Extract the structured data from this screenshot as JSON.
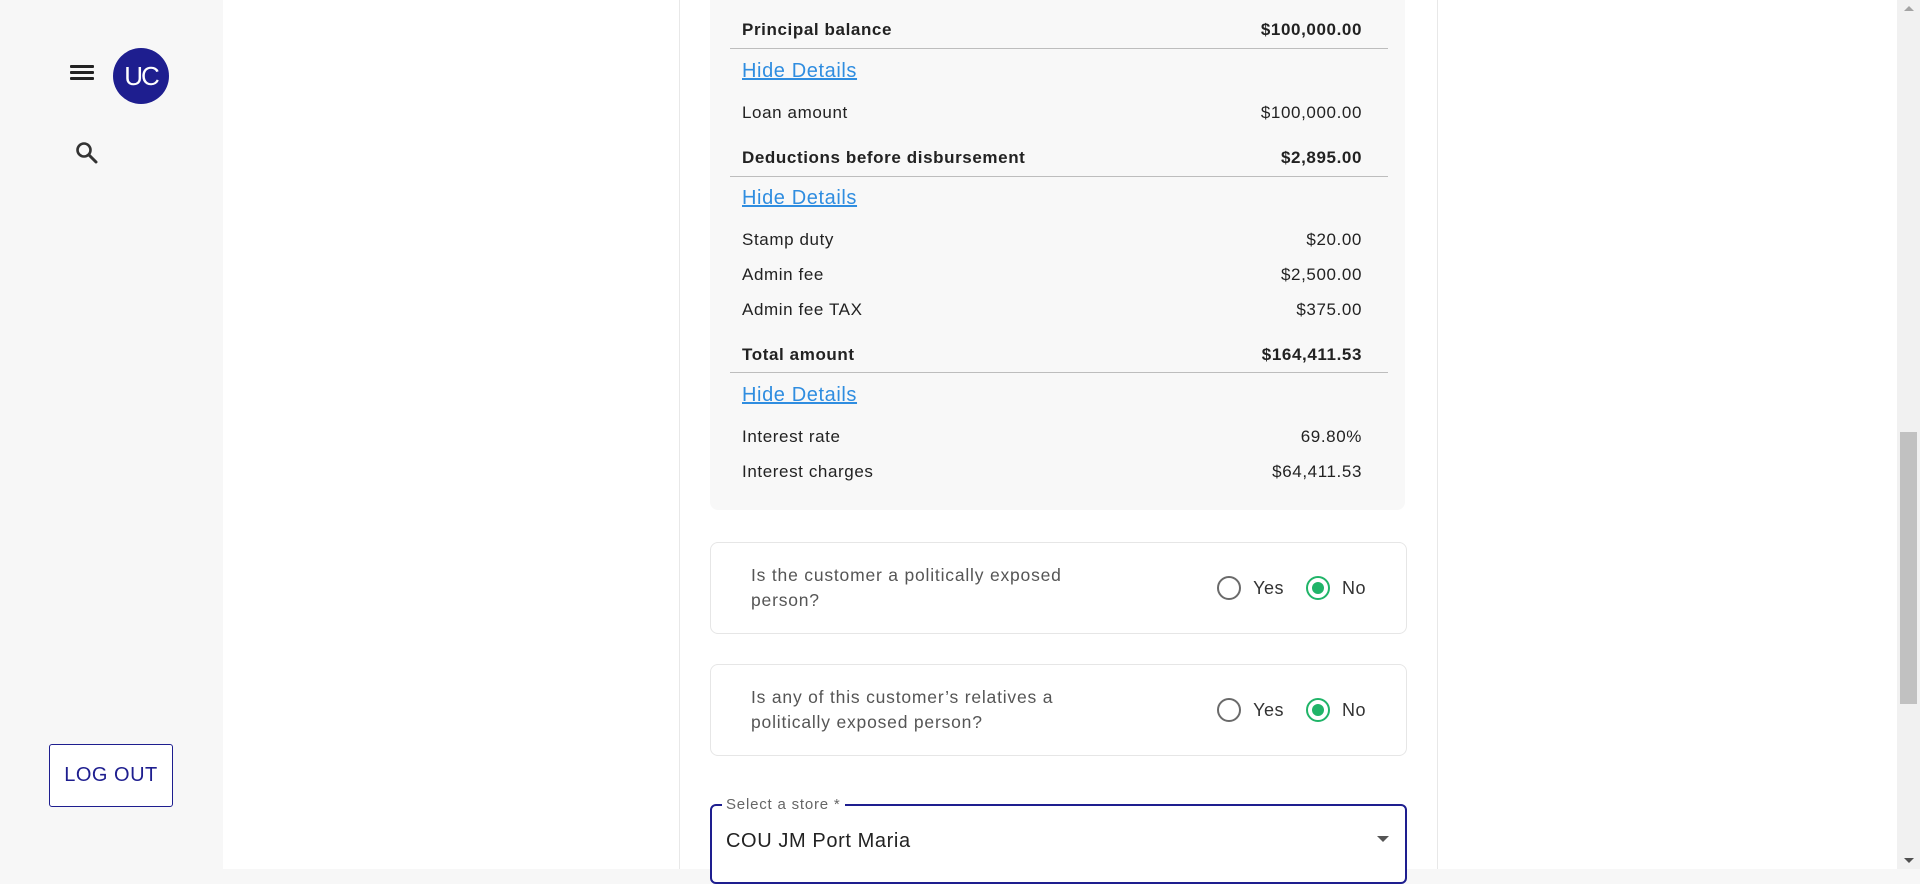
{
  "sidebar": {
    "avatar_text": "UC",
    "logout_label": "LOG OUT"
  },
  "summary": {
    "principal_label": "Principal balance",
    "principal_value": "$100,000.00",
    "hide_details_1": "Hide Details",
    "loan_amount_label": "Loan amount",
    "loan_amount_value": "$100,000.00",
    "deductions_label": "Deductions before disbursement",
    "deductions_value": "$2,895.00",
    "hide_details_2": "Hide Details",
    "stamp_duty_label": "Stamp duty",
    "stamp_duty_value": "$20.00",
    "admin_fee_label": "Admin fee",
    "admin_fee_value": "$2,500.00",
    "admin_fee_tax_label": "Admin fee TAX",
    "admin_fee_tax_value": "$375.00",
    "total_label": "Total amount",
    "total_value": "$164,411.53",
    "hide_details_3": "Hide Details",
    "interest_rate_label": "Interest rate",
    "interest_rate_value": "69.80%",
    "interest_charges_label": "Interest charges",
    "interest_charges_value": "$64,411.53"
  },
  "pep_question": {
    "text": "Is the customer a politically exposed person?",
    "yes": "Yes",
    "no": "No",
    "selected": "No"
  },
  "relatives_question": {
    "text": "Is any of this customer’s relatives a politically exposed person?",
    "yes": "Yes",
    "no": "No",
    "selected": "No"
  },
  "store_select": {
    "label": "Select a store *",
    "value": "COU JM Port Maria"
  },
  "colors": {
    "brand": "#1e1e8f",
    "link": "#2f8de0",
    "radio_checked": "#20b468"
  }
}
